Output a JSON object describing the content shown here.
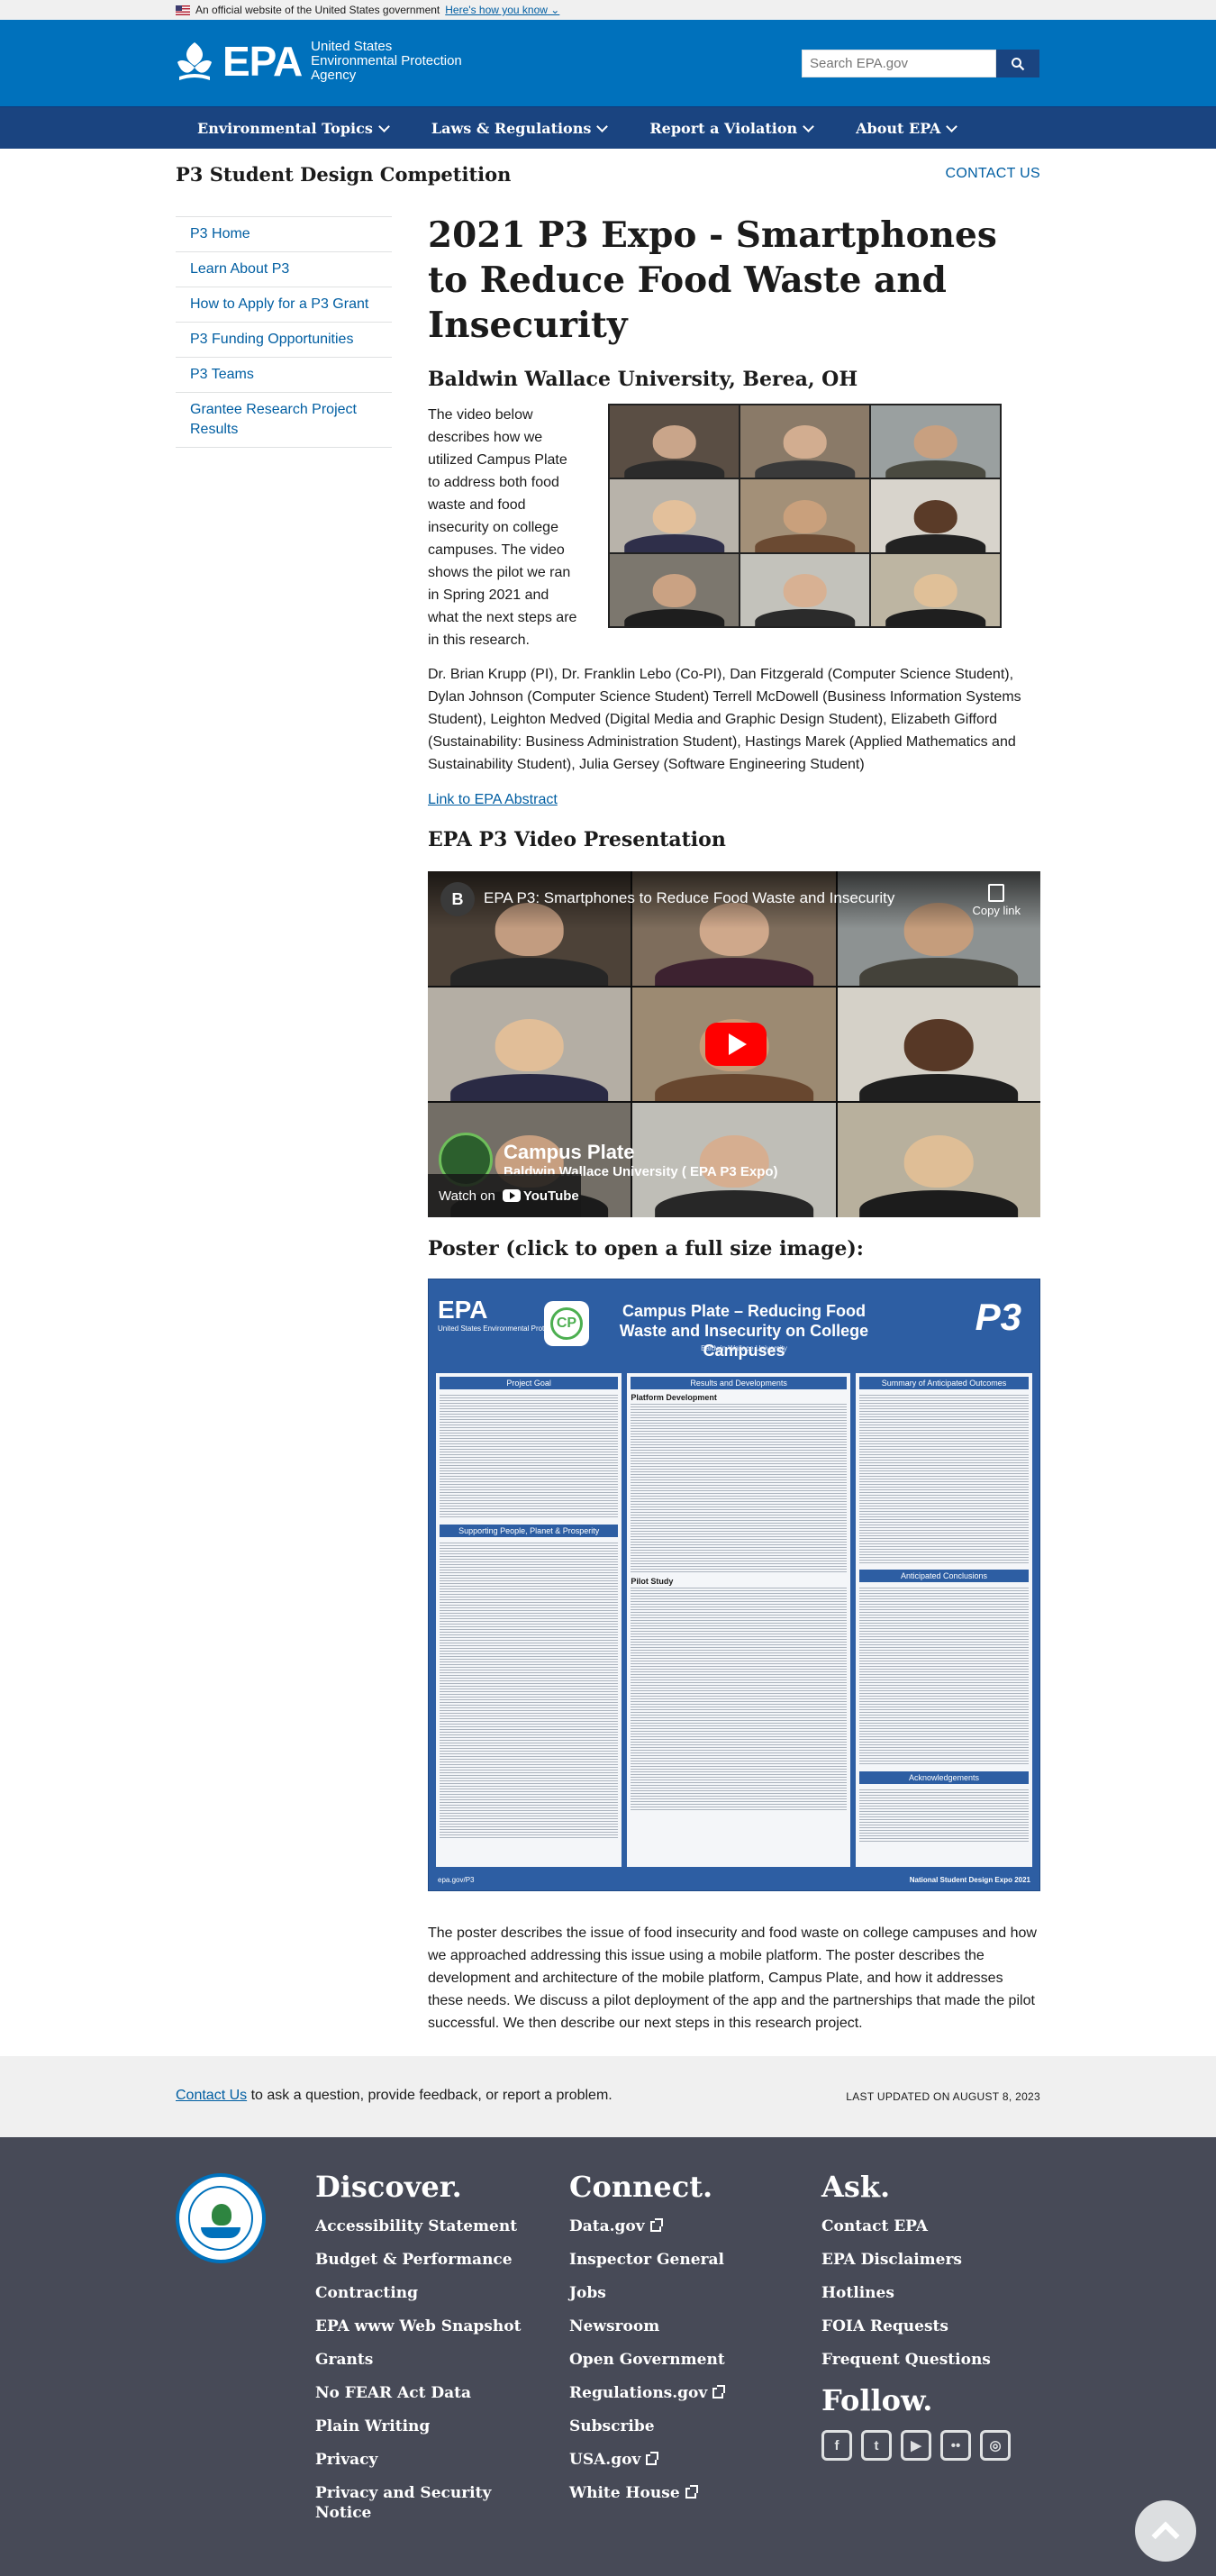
{
  "banner": {
    "official_text": "An official website of the United States government",
    "how_you_know": "Here's how you know"
  },
  "header": {
    "logo_word": "EPA",
    "agency_name_line1": "United States",
    "agency_name_line2": "Environmental Protection",
    "agency_name_line3": "Agency",
    "search_placeholder": "Search EPA.gov"
  },
  "nav": {
    "items": [
      {
        "label": "Environmental Topics"
      },
      {
        "label": "Laws & Regulations"
      },
      {
        "label": "Report a Violation"
      },
      {
        "label": "About EPA"
      }
    ]
  },
  "page": {
    "section_title": "P3 Student Design Competition",
    "contact_us": "CONTACT US"
  },
  "sidebar": {
    "items": [
      {
        "label": "P3 Home"
      },
      {
        "label": "Learn About P3"
      },
      {
        "label": "How to Apply for a P3 Grant"
      },
      {
        "label": "P3 Funding Opportunities"
      },
      {
        "label": "P3 Teams"
      },
      {
        "label": "Grantee Research Project Results"
      }
    ]
  },
  "main": {
    "title": "2021 P3 Expo - Smartphones to Reduce Food Waste and Insecurity",
    "university": "Baldwin Wallace University, Berea, OH",
    "intro": "The video below describes how we utilized Campus Plate to address both food waste and food insecurity on college campuses. The video shows the pilot we ran in Spring 2021 and what the next steps are in this research.",
    "people": "Dr. Brian Krupp (PI), Dr. Franklin Lebo (Co-PI), Dan Fitzgerald (Computer Science Student), Dylan Johnson (Computer Science Student) Terrell McDowell (Business Information Systems Student), Leighton Medved (Digital Media and Graphic Design Student), Elizabeth Gifford (Sustainability: Business Administration Student), Hastings Marek (Applied Mathematics and Sustainability Student), Julia Gersey (Software Engineering Student)",
    "abstract_link": "Link to EPA Abstract",
    "video_heading": "EPA P3 Video Presentation",
    "video": {
      "channel_initial": "B",
      "title": "EPA P3: Smartphones to Reduce Food Waste and Insecurity",
      "copy_link": "Copy link",
      "overlay_title": "Campus Plate",
      "overlay_subtitle": "Baldwin Wallace University ( EPA P3 Expo)",
      "watch_on": "Watch on",
      "youtube": "YouTube"
    },
    "poster_heading": "Poster (click to open a full size image):",
    "poster": {
      "logo": "EPA",
      "logo_sub": "United States Environmental Protection Agency",
      "cp": "CP",
      "title": "Campus Plate – Reducing Food Waste and Insecurity on College Campuses",
      "subtitle": "Baldwin Wallace University",
      "p3": "P3",
      "col1_head": "Project Goal",
      "col2_head": "Results and Developments",
      "col3_head": "Summary of Anticipated Outcomes",
      "col1_head2": "Supporting People, Planet & Prosperity",
      "col2_sub1": "Platform Development",
      "col2_sub2": "Pilot Study",
      "col3_head2": "Anticipated Conclusions",
      "col3_head3": "Acknowledgements",
      "footer_left": "epa.gov/P3",
      "footer_right": "National Student Design Expo 2021"
    },
    "poster_description": "The poster describes the issue of food insecurity and food waste on college campuses and how we approached addressing this issue using a mobile platform. The poster describes the development and architecture of the mobile platform, Campus Plate, and how it addresses these needs. We discuss a pilot deployment of the app and the partnerships that made the pilot successful. We then describe our next steps in this research project."
  },
  "contact_strip": {
    "link": "Contact Us",
    "text": "to ask a question, provide feedback, or report a problem.",
    "updated": "LAST UPDATED ON AUGUST 8, 2023"
  },
  "footer": {
    "discover": {
      "heading": "Discover.",
      "links": [
        "Accessibility Statement",
        "Budget & Performance",
        "Contracting",
        "EPA www Web Snapshot",
        "Grants",
        "No FEAR Act Data",
        "Plain Writing",
        "Privacy",
        "Privacy and Security Notice"
      ]
    },
    "connect": {
      "heading": "Connect.",
      "links": [
        "Data.gov",
        "Inspector General",
        "Jobs",
        "Newsroom",
        "Open Government",
        "Regulations.gov",
        "Subscribe",
        "USA.gov",
        "White House"
      ]
    },
    "ask": {
      "heading": "Ask.",
      "links": [
        "Contact EPA",
        "EPA Disclaimers",
        "Hotlines",
        "FOIA Requests",
        "Frequent Questions"
      ]
    },
    "follow": {
      "heading": "Follow.",
      "icons": [
        "facebook-icon",
        "twitter-icon",
        "youtube-icon",
        "flickr-icon",
        "instagram-icon"
      ]
    }
  },
  "colors": {
    "header_blue": "#0071bc",
    "nav_navy": "#1a4480",
    "link_blue": "#005ea2",
    "footer_gray": "#474a57"
  }
}
